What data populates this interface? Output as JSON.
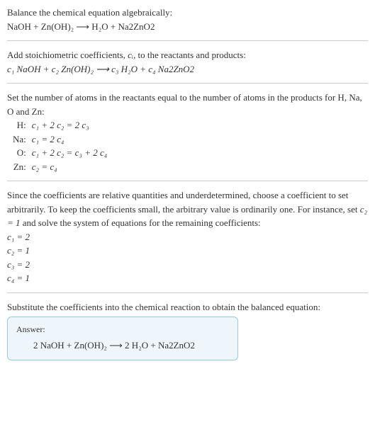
{
  "header": {
    "line1": "Balance the chemical equation algebraically:",
    "eq": "NaOH + Zn(OH)₂ ⟶ H₂O + Na2ZnO2"
  },
  "stoich": {
    "text_before": "Add stoichiometric coefficients, ",
    "ci": "cᵢ",
    "text_after": ", to the reactants and products:",
    "eq": "c₁ NaOH + c₂ Zn(OH)₂ ⟶ c₃ H₂O + c₄ Na2ZnO2"
  },
  "atoms": {
    "intro": "Set the number of atoms in the reactants equal to the number of atoms in the products for H, Na, O and Zn:",
    "rows": [
      {
        "label": "H:",
        "eq": "c₁ + 2 c₂ = 2 c₃"
      },
      {
        "label": "Na:",
        "eq": "c₁ = 2 c₄"
      },
      {
        "label": "O:",
        "eq": "c₁ + 2 c₂ = c₃ + 2 c₄"
      },
      {
        "label": "Zn:",
        "eq": "c₂ = c₄"
      }
    ]
  },
  "solve": {
    "para_a": "Since the coefficients are relative quantities and underdetermined, choose a coefficient to set arbitrarily. To keep the coefficients small, the arbitrary value is ordinarily one. For instance, set ",
    "c2eq": "c₂ = 1",
    "para_b": " and solve the system of equations for the remaining coefficients:",
    "coeffs": [
      "c₁ = 2",
      "c₂ = 1",
      "c₃ = 2",
      "c₄ = 1"
    ]
  },
  "subst": {
    "text": "Substitute the coefficients into the chemical reaction to obtain the balanced equation:"
  },
  "answer": {
    "label": "Answer:",
    "eq": "2 NaOH + Zn(OH)₂ ⟶ 2 H₂O + Na2ZnO2"
  }
}
